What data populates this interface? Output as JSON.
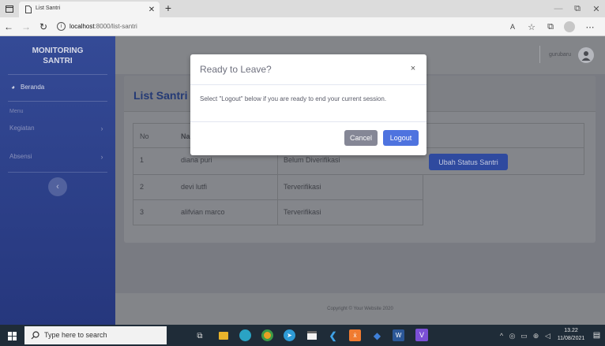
{
  "browser": {
    "tab_title": "List Santri",
    "address_host": "localhost",
    "address_path": ":8000/list-santri"
  },
  "sidebar": {
    "brand_line1": "MONITORING",
    "brand_line2": "SANTRI",
    "home_label": "Beranda",
    "section_label": "Menu",
    "items": [
      {
        "label": "Kegiatan"
      },
      {
        "label": "Absensi"
      }
    ]
  },
  "topbar": {
    "user_name": "gurubaru"
  },
  "page": {
    "heading": "List Santri"
  },
  "table": {
    "headers": [
      "No",
      "Na"
    ],
    "rows": [
      {
        "no": "1",
        "name": "diana puri",
        "status": "Belum Diverifikasi",
        "action": "Ubah Status Santri"
      },
      {
        "no": "2",
        "name": "devi lutfi",
        "status": "Terverifikasi"
      },
      {
        "no": "3",
        "name": "alifvian marco",
        "status": "Terverifikasi"
      }
    ]
  },
  "footer": {
    "copyright": "Copyright © Your Website 2020"
  },
  "modal": {
    "title": "Ready to Leave?",
    "body": "Select \"Logout\" below if you are ready to end your current session.",
    "cancel_label": "Cancel",
    "logout_label": "Logout"
  },
  "taskbar": {
    "search_placeholder": "Type here to search",
    "time": "13.22",
    "date": "11/08/2021"
  },
  "colors": {
    "accent": "#4e73df",
    "secondary": "#858796",
    "sidebar": "#2c3f8a",
    "taskbar": "#1f2c38"
  }
}
